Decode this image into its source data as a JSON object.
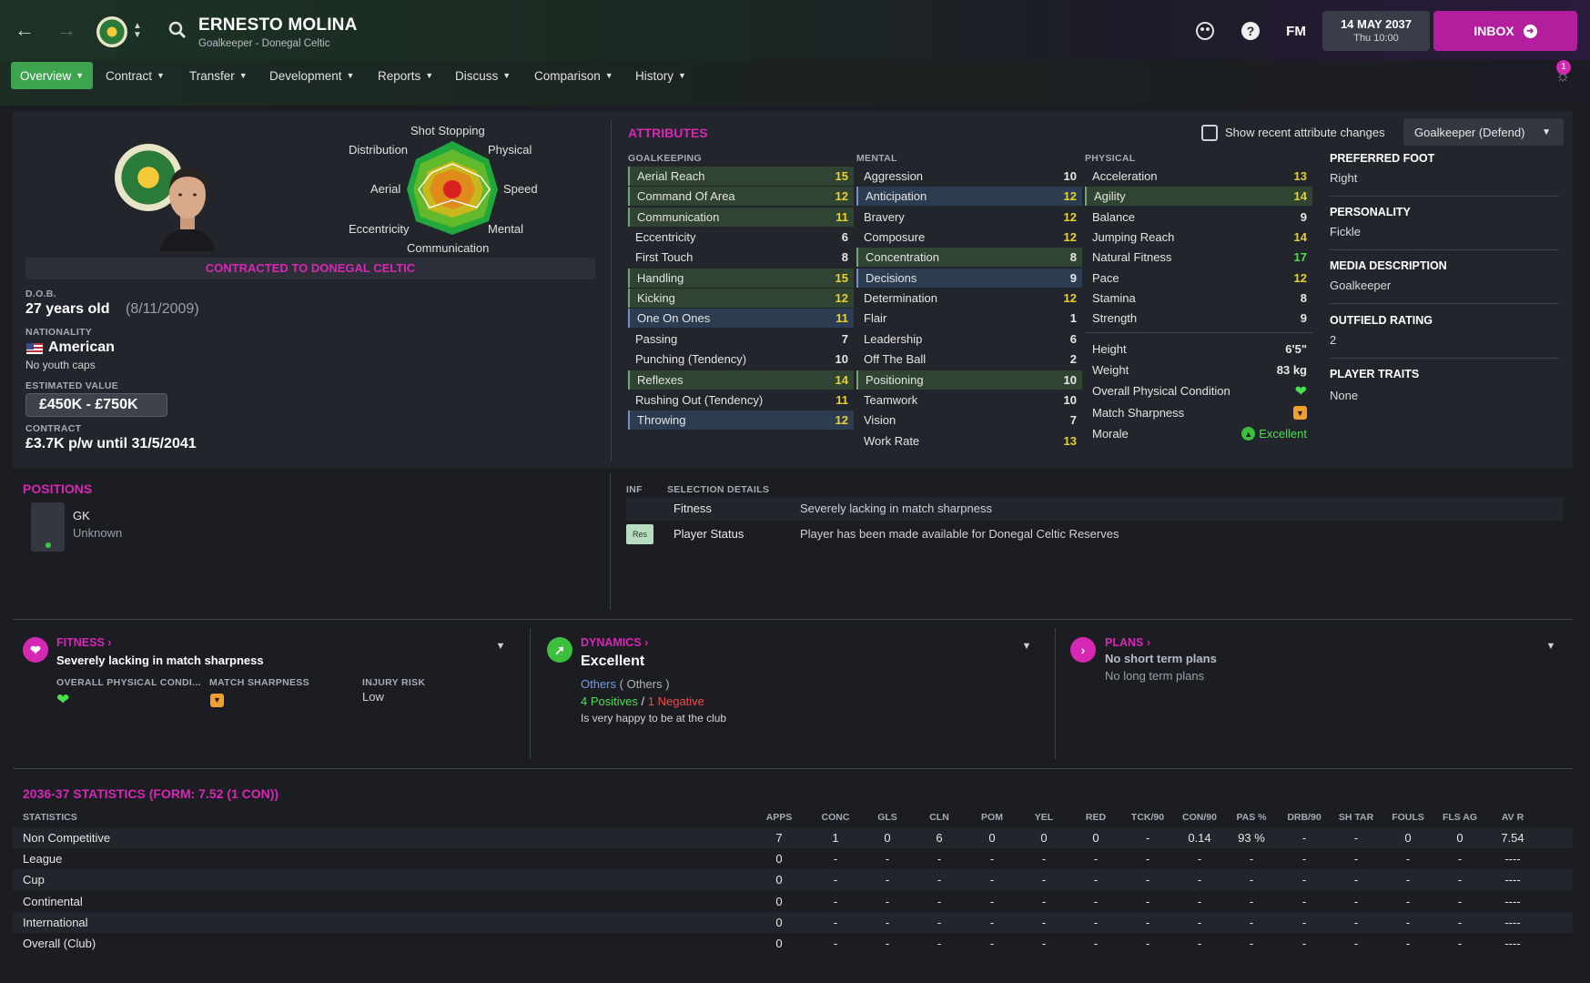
{
  "header": {
    "player_name": "ERNESTO MOLINA",
    "player_sub": "Goalkeeper - Donegal Celtic",
    "date": "14 MAY 2037",
    "time": "Thu 10:00",
    "fm_label": "FM",
    "inbox_label": "INBOX",
    "notification_count": "1"
  },
  "tabs": [
    {
      "label": "Overview"
    },
    {
      "label": "Contract"
    },
    {
      "label": "Transfer"
    },
    {
      "label": "Development"
    },
    {
      "label": "Reports"
    },
    {
      "label": "Discuss"
    },
    {
      "label": "Comparison"
    },
    {
      "label": "History"
    }
  ],
  "radar": {
    "labels": [
      "Shot Stopping",
      "Physical",
      "Speed",
      "Mental",
      "Communication",
      "Eccentricity",
      "Aerial",
      "Distribution"
    ]
  },
  "profile": {
    "contract_banner": "CONTRACTED TO DONEGAL CELTIC",
    "dob_label": "D.O.B.",
    "age": "27 years old",
    "dob": "(8/11/2009)",
    "nationality_label": "NATIONALITY",
    "nationality": "American",
    "youth_caps": "No youth caps",
    "value_label": "ESTIMATED VALUE",
    "value": "£450K - £750K",
    "contract_label": "CONTRACT",
    "contract": "£3.7K p/w until 31/5/2041"
  },
  "attributes": {
    "title": "ATTRIBUTES",
    "show_changes_label": "Show recent attribute changes",
    "role_select": "Goalkeeper (Defend)",
    "goalkeeping_label": "GOALKEEPING",
    "mental_label": "MENTAL",
    "physical_label": "PHYSICAL",
    "goalkeeping": [
      {
        "name": "Aerial Reach",
        "value": "15",
        "hl": "green",
        "color": "yellow"
      },
      {
        "name": "Command Of Area",
        "value": "12",
        "hl": "green",
        "color": "yellow"
      },
      {
        "name": "Communication",
        "value": "11",
        "hl": "green",
        "color": "yellow"
      },
      {
        "name": "Eccentricity",
        "value": "6",
        "hl": "",
        "color": "white"
      },
      {
        "name": "First Touch",
        "value": "8",
        "hl": "",
        "color": "white"
      },
      {
        "name": "Handling",
        "value": "15",
        "hl": "green",
        "color": "yellow"
      },
      {
        "name": "Kicking",
        "value": "12",
        "hl": "green",
        "color": "yellow"
      },
      {
        "name": "One On Ones",
        "value": "11",
        "hl": "blue",
        "color": "yellow"
      },
      {
        "name": "Passing",
        "value": "7",
        "hl": "",
        "color": "white"
      },
      {
        "name": "Punching (Tendency)",
        "value": "10",
        "hl": "",
        "color": "white"
      },
      {
        "name": "Reflexes",
        "value": "14",
        "hl": "green",
        "color": "yellow"
      },
      {
        "name": "Rushing Out (Tendency)",
        "value": "11",
        "hl": "",
        "color": "yellow"
      },
      {
        "name": "Throwing",
        "value": "12",
        "hl": "blue",
        "color": "yellow"
      }
    ],
    "mental": [
      {
        "name": "Aggression",
        "value": "10",
        "hl": "",
        "color": "white"
      },
      {
        "name": "Anticipation",
        "value": "12",
        "hl": "blue",
        "color": "yellow"
      },
      {
        "name": "Bravery",
        "value": "12",
        "hl": "",
        "color": "yellow"
      },
      {
        "name": "Composure",
        "value": "12",
        "hl": "",
        "color": "yellow"
      },
      {
        "name": "Concentration",
        "value": "8",
        "hl": "green",
        "color": "white"
      },
      {
        "name": "Decisions",
        "value": "9",
        "hl": "blue",
        "color": "white"
      },
      {
        "name": "Determination",
        "value": "12",
        "hl": "",
        "color": "yellow"
      },
      {
        "name": "Flair",
        "value": "1",
        "hl": "",
        "color": "white"
      },
      {
        "name": "Leadership",
        "value": "6",
        "hl": "",
        "color": "white"
      },
      {
        "name": "Off The Ball",
        "value": "2",
        "hl": "",
        "color": "white"
      },
      {
        "name": "Positioning",
        "value": "10",
        "hl": "green",
        "color": "white"
      },
      {
        "name": "Teamwork",
        "value": "10",
        "hl": "",
        "color": "white"
      },
      {
        "name": "Vision",
        "value": "7",
        "hl": "",
        "color": "white"
      },
      {
        "name": "Work Rate",
        "value": "13",
        "hl": "",
        "color": "yellow"
      }
    ],
    "physical": [
      {
        "name": "Acceleration",
        "value": "13",
        "hl": "",
        "color": "yellow"
      },
      {
        "name": "Agility",
        "value": "14",
        "hl": "green",
        "color": "yellow"
      },
      {
        "name": "Balance",
        "value": "9",
        "hl": "",
        "color": "white"
      },
      {
        "name": "Jumping Reach",
        "value": "14",
        "hl": "",
        "color": "yellow"
      },
      {
        "name": "Natural Fitness",
        "value": "17",
        "hl": "",
        "color": "green"
      },
      {
        "name": "Pace",
        "value": "12",
        "hl": "",
        "color": "yellow"
      },
      {
        "name": "Stamina",
        "value": "8",
        "hl": "",
        "color": "white"
      },
      {
        "name": "Strength",
        "value": "9",
        "hl": "",
        "color": "white"
      }
    ],
    "extra": {
      "height_label": "Height",
      "height": "6'5\"",
      "weight_label": "Weight",
      "weight": "83 kg",
      "condition_label": "Overall Physical Condition",
      "sharpness_label": "Match Sharpness",
      "morale_label": "Morale",
      "morale": "Excellent"
    }
  },
  "right_info": {
    "pref_foot_label": "PREFERRED FOOT",
    "pref_foot": "Right",
    "personality_label": "PERSONALITY",
    "personality": "Fickle",
    "media_label": "MEDIA DESCRIPTION",
    "media": "Goalkeeper",
    "outfield_label": "OUTFIELD RATING",
    "outfield": "2",
    "traits_label": "PLAYER TRAITS",
    "traits": "None"
  },
  "positions": {
    "title": "POSITIONS",
    "pos": "GK",
    "familiarity": "Unknown"
  },
  "selection": {
    "inf_label": "INF",
    "title": "SELECTION DETAILS",
    "rows": [
      {
        "badge": "",
        "label": "Fitness",
        "value": "Severely lacking in match sharpness"
      },
      {
        "badge": "Res",
        "label": "Player Status",
        "value": "Player has been made available for Donegal Celtic Reserves"
      }
    ]
  },
  "cards": {
    "fitness": {
      "title": "FITNESS",
      "headline": "Severely lacking in match sharpness",
      "col1": "OVERALL PHYSICAL CONDI...",
      "col2": "MATCH SHARPNESS",
      "col3": "INJURY RISK",
      "injury": "Low"
    },
    "dynamics": {
      "title": "DYNAMICS",
      "headline": "Excellent",
      "group": "Others",
      "group_paren": "( Others )",
      "positives": "4 Positives",
      "sep": "/",
      "negatives": "1 Negative",
      "note": "Is very happy to be at the club"
    },
    "plans": {
      "title": "PLANS",
      "short": "No short term plans",
      "long": "No long term plans"
    }
  },
  "stats": {
    "title": "2036-37 STATISTICS (FORM: 7.52 (1 CON))",
    "columns": [
      "STATISTICS",
      "APPS",
      "CONC",
      "GLS",
      "CLN",
      "POM",
      "YEL",
      "RED",
      "TCK/90",
      "CON/90",
      "PAS %",
      "DRB/90",
      "SH TAR",
      "FOULS",
      "FLS AG",
      "AV R"
    ],
    "rows": [
      [
        "Non Competitive",
        "7",
        "1",
        "0",
        "6",
        "0",
        "0",
        "0",
        "-",
        "0.14",
        "93 %",
        "-",
        "-",
        "0",
        "0",
        "7.54"
      ],
      [
        "League",
        "0",
        "-",
        "-",
        "-",
        "-",
        "-",
        "-",
        "-",
        "-",
        "-",
        "-",
        "-",
        "-",
        "-",
        "----"
      ],
      [
        "Cup",
        "0",
        "-",
        "-",
        "-",
        "-",
        "-",
        "-",
        "-",
        "-",
        "-",
        "-",
        "-",
        "-",
        "-",
        "----"
      ],
      [
        "Continental",
        "0",
        "-",
        "-",
        "-",
        "-",
        "-",
        "-",
        "-",
        "-",
        "-",
        "-",
        "-",
        "-",
        "-",
        "----"
      ],
      [
        "International",
        "0",
        "-",
        "-",
        "-",
        "-",
        "-",
        "-",
        "-",
        "-",
        "-",
        "-",
        "-",
        "-",
        "-",
        "----"
      ],
      [
        "Overall (Club)",
        "0",
        "-",
        "-",
        "-",
        "-",
        "-",
        "-",
        "-",
        "-",
        "-",
        "-",
        "-",
        "-",
        "-",
        "----"
      ]
    ]
  }
}
